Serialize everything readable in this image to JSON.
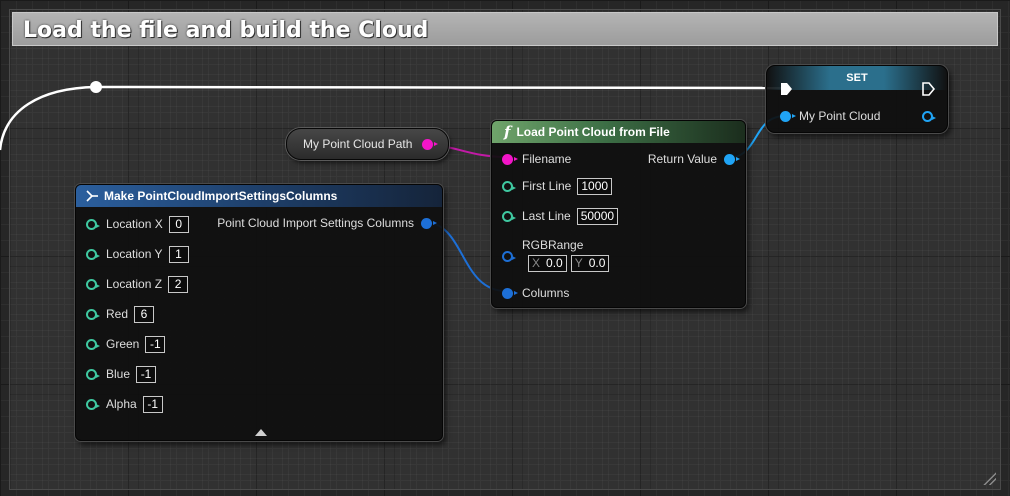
{
  "comment": {
    "title": "Load the file and build the Cloud"
  },
  "variable_node": {
    "label": "My Point Cloud Path"
  },
  "load_node": {
    "title": "Load Point Cloud from File",
    "function_glyph": "f",
    "pins": {
      "filename": "Filename",
      "return_value": "Return Value",
      "first_line": "First Line",
      "first_line_value": "1000",
      "last_line": "Last Line",
      "last_line_value": "50000",
      "rgb_range": "RGBRange",
      "rgb_x_axis": "X",
      "rgb_x_value": "0.0",
      "rgb_y_axis": "Y",
      "rgb_y_value": "0.0",
      "columns": "Columns"
    }
  },
  "make_node": {
    "title": "Make PointCloudImportSettingsColumns",
    "output": "Point Cloud Import Settings Columns",
    "fields": [
      {
        "label": "Location X",
        "value": "0"
      },
      {
        "label": "Location Y",
        "value": "1"
      },
      {
        "label": "Location Z",
        "value": "2"
      },
      {
        "label": "Red",
        "value": "6"
      },
      {
        "label": "Green",
        "value": "-1"
      },
      {
        "label": "Blue",
        "value": "-1"
      },
      {
        "label": "Alpha",
        "value": "-1"
      }
    ]
  },
  "set_node": {
    "title": "SET",
    "pin_label": "My Point Cloud"
  },
  "colors": {
    "exec_wire": "#ffffff",
    "string_pin": "#f315c8",
    "struct_pin": "#1d6fd6",
    "object_pin": "#20a4f5",
    "int_pin": "#3fc9a1"
  }
}
